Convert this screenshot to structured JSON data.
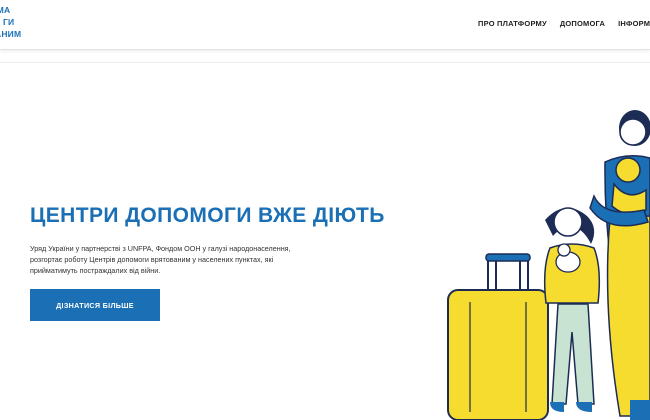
{
  "logo": {
    "line1": "РМА",
    "line2": "ГИ",
    "line3": "АНИМ"
  },
  "nav": {
    "items": [
      {
        "label": "ПРО ПЛАТФОРМУ"
      },
      {
        "label": "ДОПОМОГА"
      },
      {
        "label": "ІНФОРМА"
      }
    ]
  },
  "hero": {
    "title": "ЦЕНТРИ ДОПОМОГИ ВЖЕ ДІЮТЬ",
    "description": "Уряд України у партнерстві з UNFPA, Фондом ООН у галузі народонаселення, розгортає роботу Центрів допомоги врятованим у населених пунктах, які прийматимуть постраждалих від війни.",
    "cta_label": "ДІЗНАТИСЯ БІЛЬШЕ"
  },
  "colors": {
    "brand_blue": "#1b6fb5",
    "yellow": "#f5dc2f",
    "navy": "#1c2c55"
  },
  "illustration": {
    "icon": "refugee-family-with-suitcase-illustration"
  }
}
